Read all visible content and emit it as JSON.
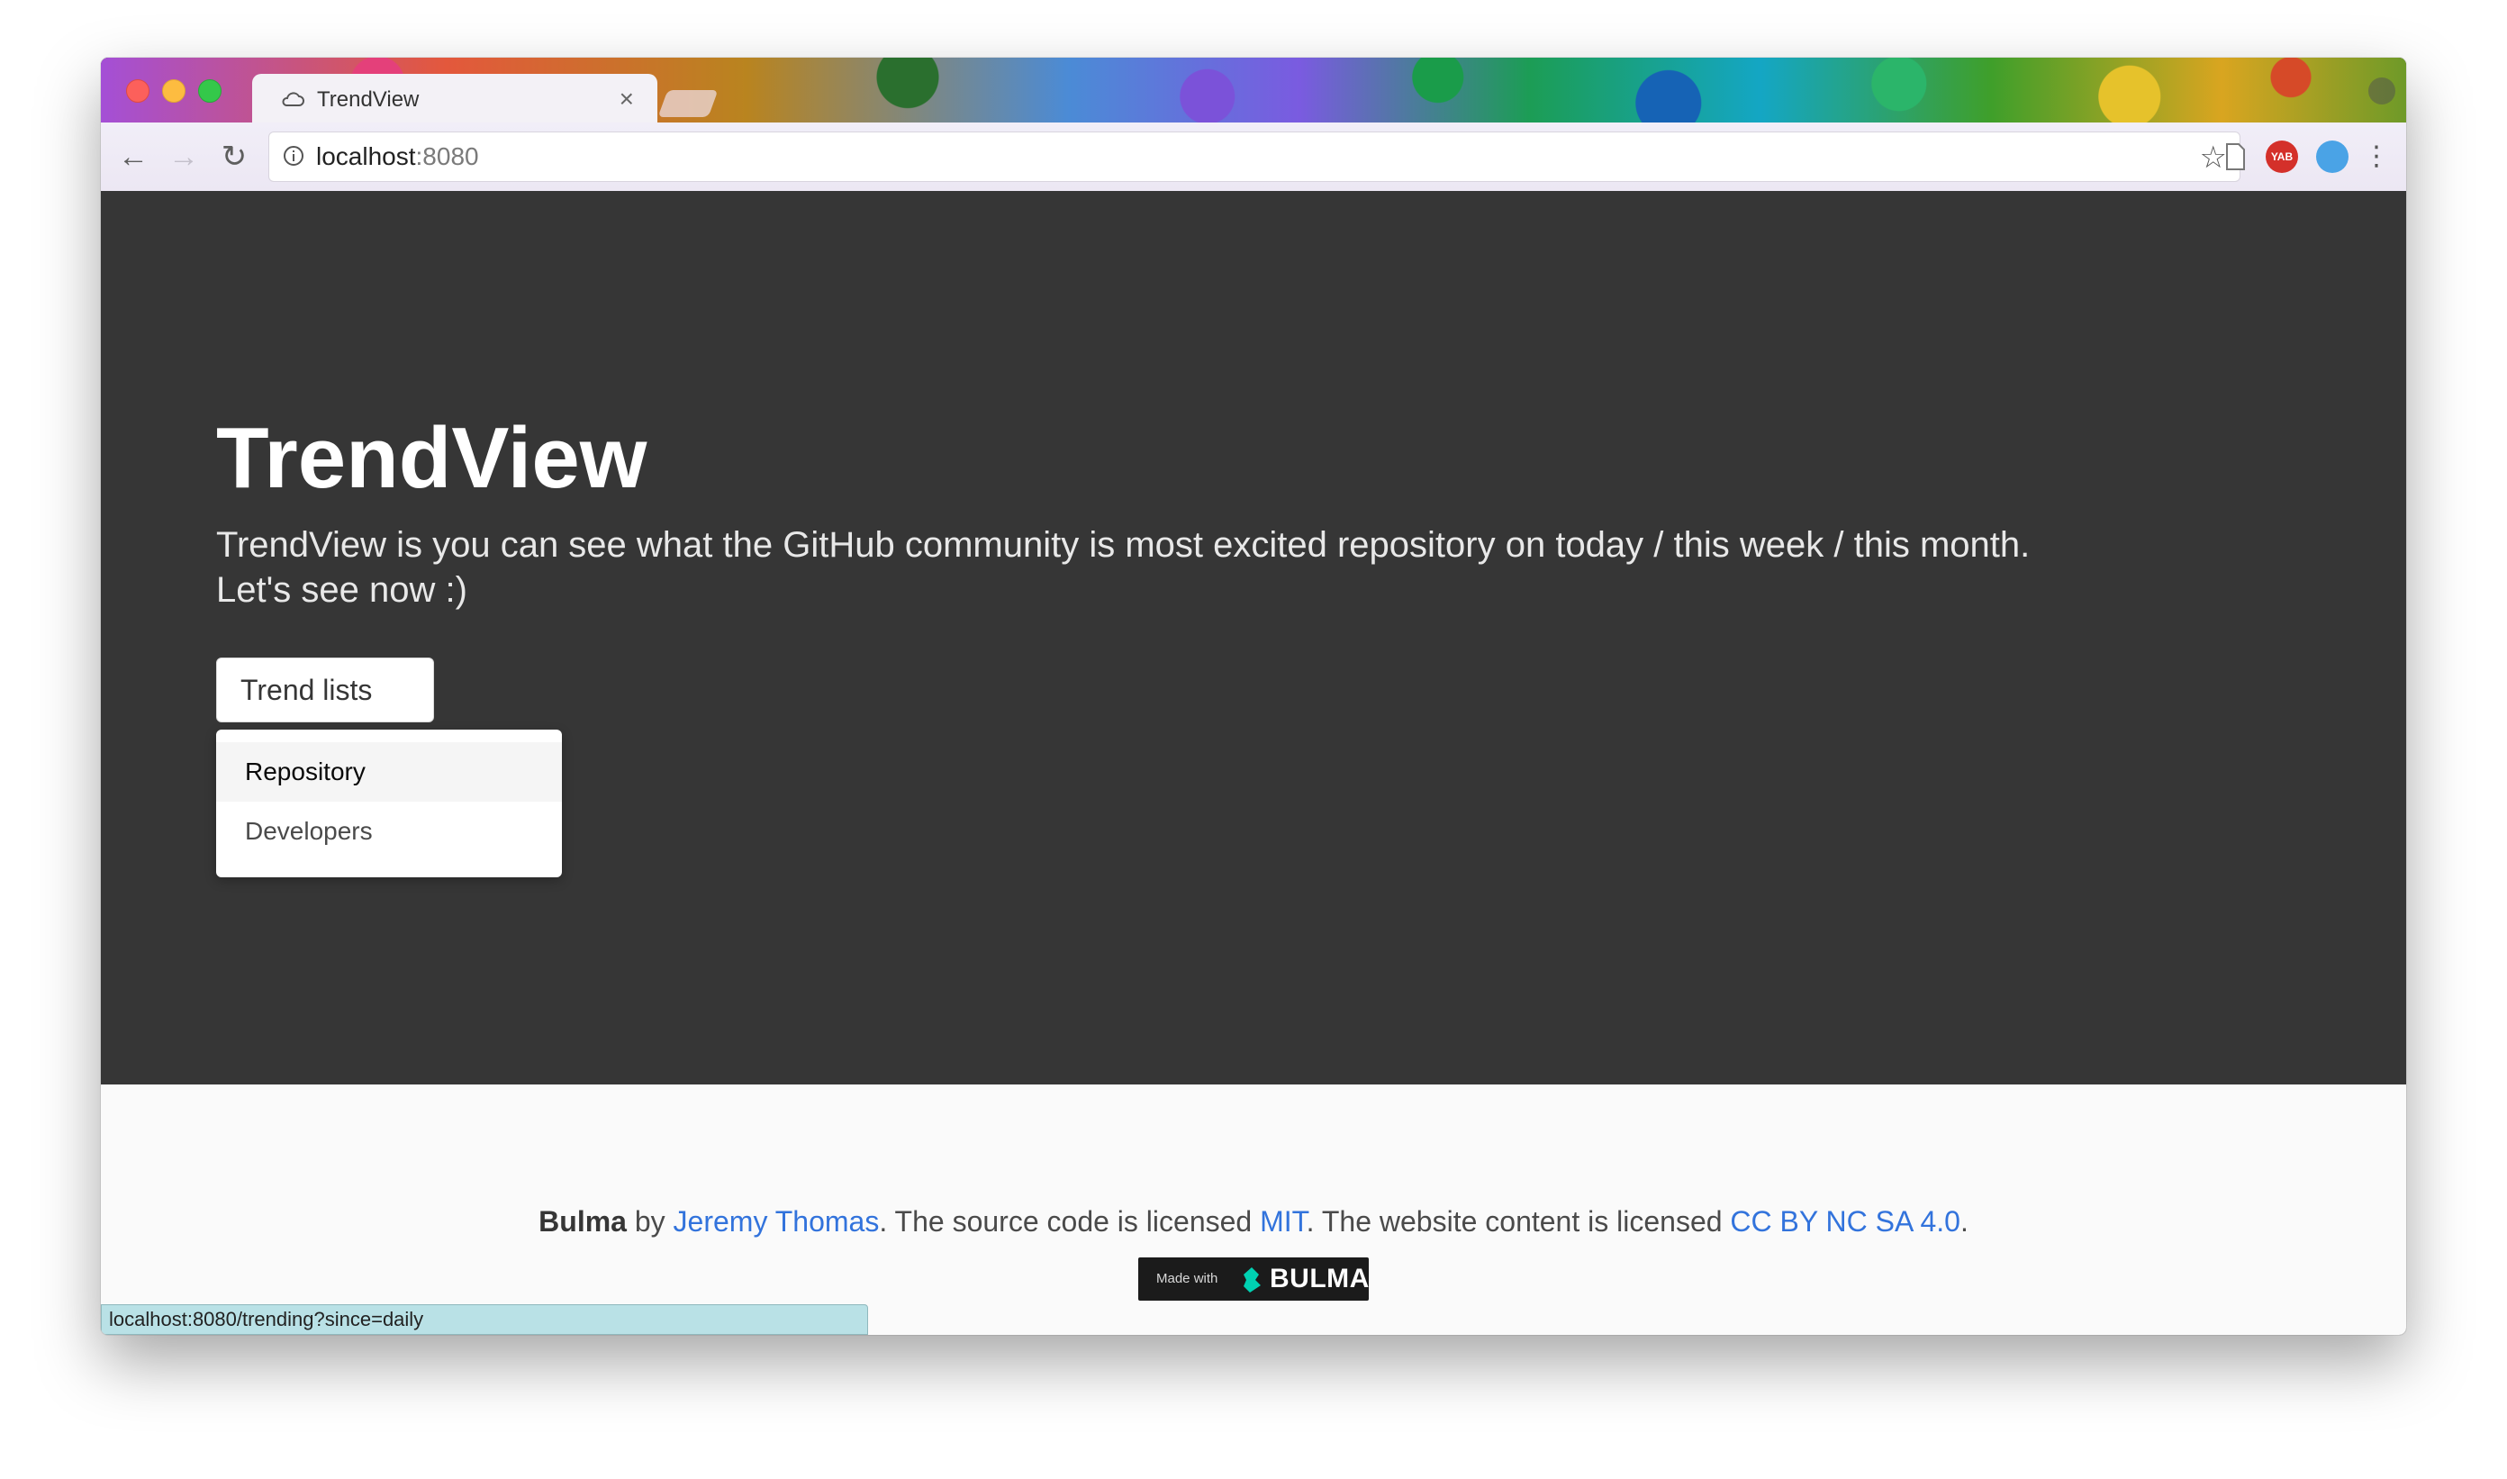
{
  "browser": {
    "tab_title": "TrendView",
    "tab_close": "×",
    "url_host": "localhost",
    "url_port": ":8080",
    "extension_yab": "YAB",
    "status_url": "localhost:8080/trending?since=daily"
  },
  "hero": {
    "title": "TrendView",
    "subtitle_line1": "TrendView is you can see what the GitHub community is most excited repository on today / this week / this month.",
    "subtitle_line2": "Let's see now :)",
    "dropdown_label": "Trend lists",
    "dropdown_items": [
      "Repository",
      "Developers"
    ]
  },
  "footer": {
    "brand": "Bulma",
    "by": " by ",
    "author": "Jeremy Thomas",
    "text_1": ". The source code is licensed ",
    "license_code": "MIT",
    "text_2": ". The website content is licensed ",
    "license_content": "CC BY NC SA 4.0",
    "text_3": ".",
    "badge_small": "Made with",
    "badge_name": "BULMA"
  },
  "colors": {
    "hero_bg": "#363636",
    "footer_bg": "#fafafa",
    "link": "#3273dc",
    "bulma_green": "#00d1b2"
  }
}
